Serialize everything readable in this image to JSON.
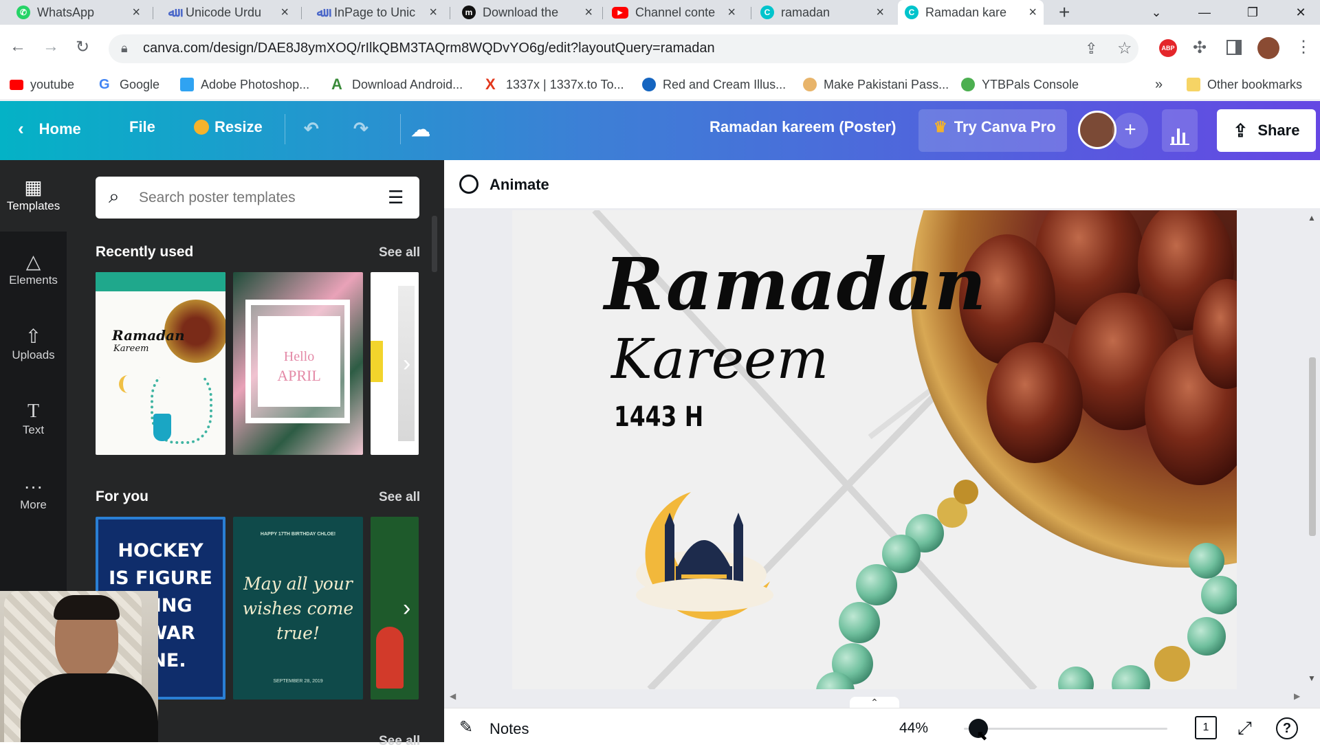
{
  "browser": {
    "tabs": [
      {
        "title": "WhatsApp",
        "icon": "whatsapp-icon",
        "color": "#25d366"
      },
      {
        "title": "Unicode Urdu",
        "icon": "inpage-icon",
        "color": "#4a67c9"
      },
      {
        "title": "InPage to Unic",
        "icon": "inpage-icon",
        "color": "#4a67c9"
      },
      {
        "title": "Download the",
        "icon": "medium-icon",
        "color": "#111111"
      },
      {
        "title": "Channel conte",
        "icon": "youtube-icon",
        "color": "#ff0000"
      },
      {
        "title": "ramadan",
        "icon": "canva-icon",
        "color": "#00c4cc"
      },
      {
        "title": "Ramadan kare",
        "icon": "canva-icon",
        "color": "#00c4cc"
      }
    ],
    "new_tab": "+",
    "address": "canva.com/design/DAE8J8ymXOQ/rIlkQBM3TAQrm8WQDvYO6g/edit?layoutQuery=ramadan",
    "bookmarks": [
      {
        "label": "youtube",
        "color": "#ff0000"
      },
      {
        "label": "Google",
        "color": "#4285f4"
      },
      {
        "label": "Adobe Photoshop...",
        "color": "#2fa3f2"
      },
      {
        "label": "Download Android...",
        "color": "#3a8b3a"
      },
      {
        "label": "1337x | 1337x.to To...",
        "color": "#e2371c"
      },
      {
        "label": "Red and Cream Illus...",
        "color": "#1565c0"
      },
      {
        "label": "Make Pakistani Pass...",
        "color": "#e8b46a"
      },
      {
        "label": "YTBPals Console",
        "color": "#4caf50"
      }
    ],
    "more_bookmarks": "»",
    "other_bookmarks": "Other bookmarks"
  },
  "canva": {
    "home": "Home",
    "file": "File",
    "resize": "Resize",
    "design_title": "Ramadan kareem (Poster)",
    "try_pro": "Try Canva Pro",
    "share": "Share",
    "rail": [
      {
        "label": "Templates",
        "icon": "templates-icon"
      },
      {
        "label": "Elements",
        "icon": "elements-icon"
      },
      {
        "label": "Uploads",
        "icon": "uploads-icon"
      },
      {
        "label": "Text",
        "icon": "text-icon"
      },
      {
        "label": "More",
        "icon": "more-icon"
      }
    ],
    "search_placeholder": "Search poster templates",
    "recently_used": "Recently used",
    "for_you": "For you",
    "see_all": "See all",
    "animate": "Animate",
    "notes": "Notes",
    "zoom": "44%",
    "zoom_level": 0.44,
    "page_count": "1",
    "help": "?"
  },
  "thumbs": {
    "recent1_title": "Ramadan",
    "recent1_sub": "Kareem",
    "recent2_line1": "Hello",
    "recent2_line2": "APRIL",
    "foryou1": "HOCKEY IS FIGURE SKATING IN A WAR ZONE.",
    "foryou1_visible": [
      "HOCKEY",
      "IS FIGURE",
      "ATING",
      "A WAR",
      "ONE."
    ],
    "foryou2_top": "HAPPY 17TH BIRTHDAY CHLOE!",
    "foryou2": "May all your wishes come true!",
    "foryou2_lines": [
      "May all your",
      "wishes come",
      "true!"
    ],
    "foryou2_date": "SEPTEMBER 28, 2019"
  },
  "poster": {
    "title": "Ramadan",
    "subtitle": "Kareem",
    "year": "1443 H"
  }
}
